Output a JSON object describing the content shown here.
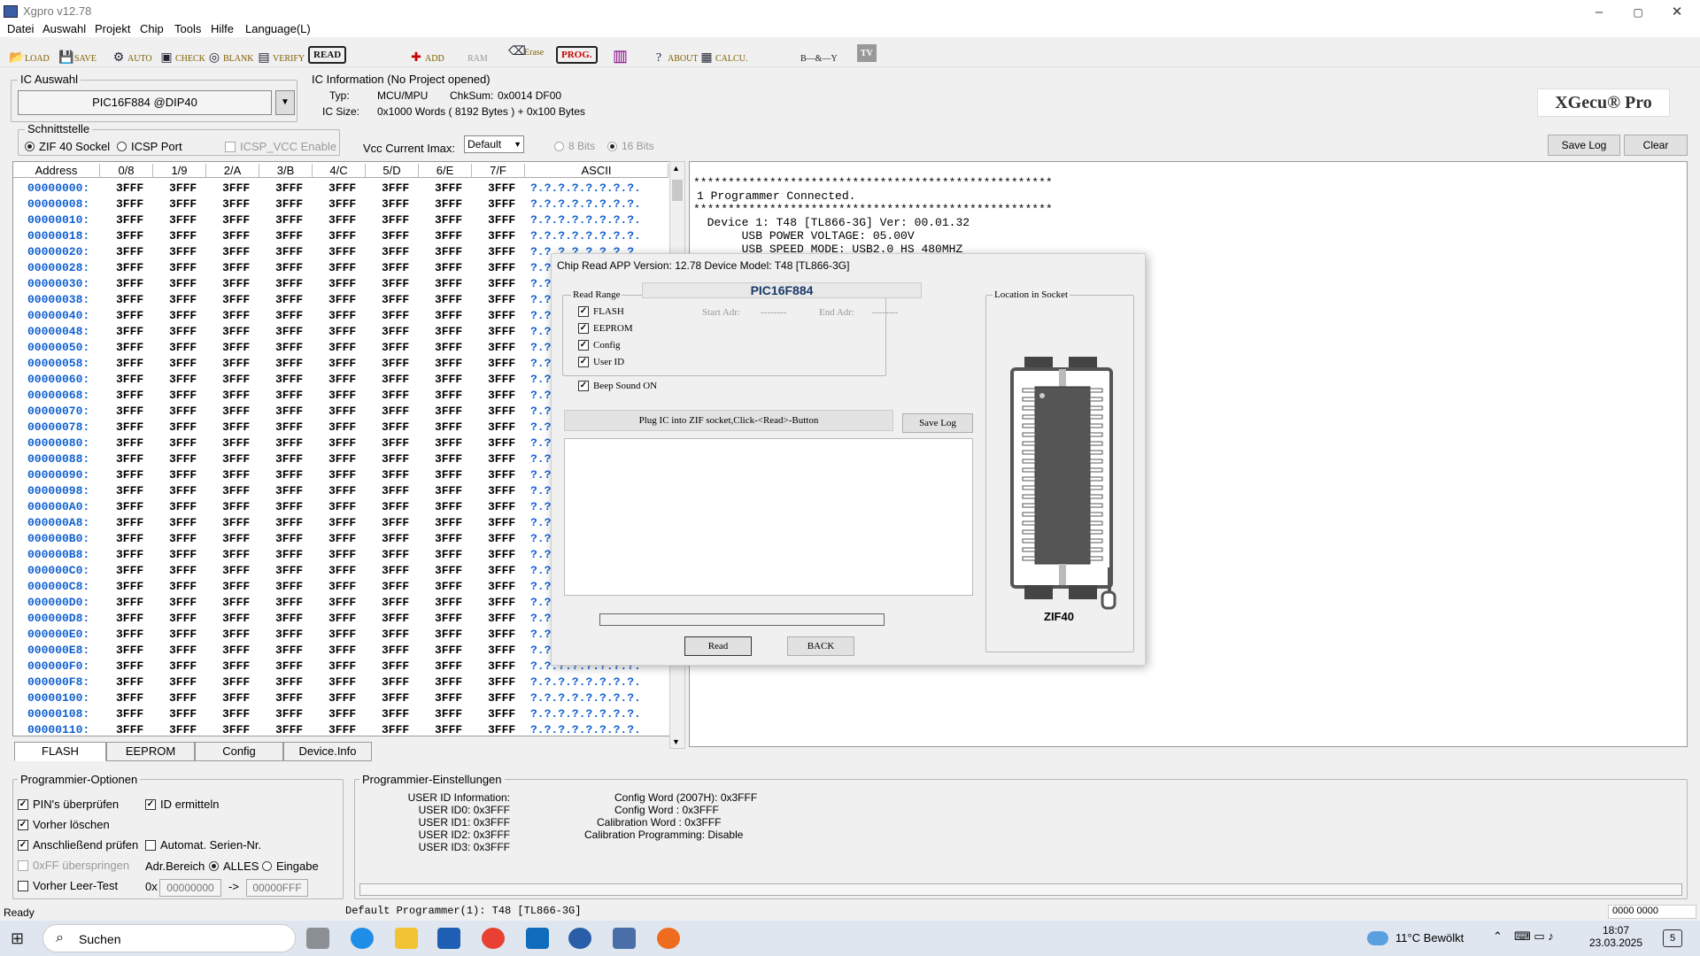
{
  "window": {
    "title": "Xgpro v12.78",
    "min": "–",
    "max": "▢",
    "close": "✕"
  },
  "menu": [
    "Datei",
    "Auswahl",
    "Projekt",
    "Chip",
    "Tools",
    "Hilfe",
    "Language(L)"
  ],
  "toolbar": {
    "load": "LOAD",
    "save": "SAVE",
    "auto": "AUTO",
    "check": "CHECK",
    "blank": "BLANK",
    "verify": "VERIFY",
    "read": "READ",
    "add": "ADD",
    "ram": "RAM",
    "erase": "Erase",
    "prog": "PROG.",
    "about": "ABOUT",
    "calcu": "CALCU.",
    "bey": "B—&—Y",
    "tv": "TV"
  },
  "ic_auswahl": {
    "label": "IC Auswahl",
    "value": "PIC16F884 @DIP40"
  },
  "ic_info": {
    "label": "IC Information (No Project opened)",
    "typ_label": "Typ:",
    "typ": "MCU/MPU",
    "chksum_label": "ChkSum:",
    "chksum": "0x0014 DF00",
    "size_label": "IC Size:",
    "size": "0x1000 Words ( 8192 Bytes ) + 0x100 Bytes"
  },
  "brand": "XGecu® Pro",
  "schnittstelle": {
    "label": "Schnittstelle",
    "zif": "ZIF 40 Sockel",
    "icsp": "ICSP Port",
    "icsp_vcc": "ICSP_VCC Enable"
  },
  "vcc": {
    "label": "Vcc Current Imax:",
    "value": "Default",
    "bits8": "8 Bits",
    "bits16": "16 Bits"
  },
  "log_buttons": {
    "save": "Save Log",
    "clear": "Clear"
  },
  "grid": {
    "headers": [
      "Address",
      "0/8",
      "1/9",
      "2/A",
      "3/B",
      "4/C",
      "5/D",
      "6/E",
      "7/F",
      "ASCII"
    ],
    "rows": [
      {
        "addr": "00000000:",
        "ascii": "?.?.?.?.?.?.?.?."
      },
      {
        "addr": "00000008:",
        "ascii": "?.?.?.?.?.?.?.?."
      },
      {
        "addr": "00000010:",
        "ascii": "?.?.?.?.?.?.?.?."
      },
      {
        "addr": "00000018:",
        "ascii": "?.?.?.?.?.?.?.?."
      },
      {
        "addr": "00000020:",
        "ascii": "?.?.?.?.?.?.?.?."
      },
      {
        "addr": "00000028:",
        "ascii": "?.?"
      },
      {
        "addr": "00000030:",
        "ascii": "?.?"
      },
      {
        "addr": "00000038:",
        "ascii": "?.?"
      },
      {
        "addr": "00000040:",
        "ascii": "?.?"
      },
      {
        "addr": "00000048:",
        "ascii": "?.?"
      },
      {
        "addr": "00000050:",
        "ascii": "?.?"
      },
      {
        "addr": "00000058:",
        "ascii": "?.?"
      },
      {
        "addr": "00000060:",
        "ascii": "?.?"
      },
      {
        "addr": "00000068:",
        "ascii": "?.?"
      },
      {
        "addr": "00000070:",
        "ascii": "?.?"
      },
      {
        "addr": "00000078:",
        "ascii": "?.?"
      },
      {
        "addr": "00000080:",
        "ascii": "?.?"
      },
      {
        "addr": "00000088:",
        "ascii": "?.?"
      },
      {
        "addr": "00000090:",
        "ascii": "?.?"
      },
      {
        "addr": "00000098:",
        "ascii": "?.?"
      },
      {
        "addr": "000000A0:",
        "ascii": "?.?"
      },
      {
        "addr": "000000A8:",
        "ascii": "?.?"
      },
      {
        "addr": "000000B0:",
        "ascii": "?.?"
      },
      {
        "addr": "000000B8:",
        "ascii": "?.?"
      },
      {
        "addr": "000000C0:",
        "ascii": "?.?"
      },
      {
        "addr": "000000C8:",
        "ascii": "?.?"
      },
      {
        "addr": "000000D0:",
        "ascii": "?.?"
      },
      {
        "addr": "000000D8:",
        "ascii": "?.?"
      },
      {
        "addr": "000000E0:",
        "ascii": "?.?"
      },
      {
        "addr": "000000E8:",
        "ascii": "?.?"
      },
      {
        "addr": "000000F0:",
        "ascii": "?.?.?.?.?.?.?.?."
      },
      {
        "addr": "000000F8:",
        "ascii": "?.?.?.?.?.?.?.?."
      },
      {
        "addr": "00000100:",
        "ascii": "?.?.?.?.?.?.?.?."
      },
      {
        "addr": "00000108:",
        "ascii": "?.?.?.?.?.?.?.?."
      },
      {
        "addr": "00000110:",
        "ascii": "?.?.?.?.?.?.?.?."
      }
    ],
    "cell": "3FFF"
  },
  "log_lines": [
    "****************************************************",
    "1 Programmer Connected.",
    "****************************************************",
    "  Device 1: T48 [TL866-3G] Ver: 00.01.32",
    "       USB POWER VOLTAGE: 05.00V",
    "       USB SPEED MODE: USB2.0 HS 480MHZ"
  ],
  "tabs": [
    "FLASH",
    "EEPROM",
    "Config",
    "Device.Info"
  ],
  "dialog": {
    "title": "Chip Read   APP Version: 12.78 Device Model: T48 [TL866-3G]",
    "chip": "PIC16F884",
    "read_range": "Read Range",
    "flash": "FLASH",
    "eeprom": "EEPROM",
    "config": "Config",
    "userid": "User ID",
    "start_label": "Start Adr:",
    "start_val": "--------",
    "end_label": "End Adr:",
    "end_val": "--------",
    "beep": "Beep Sound ON",
    "status": "Plug IC into ZIF socket,Click-<Read>-Button",
    "save_log": "Save Log",
    "read": "Read",
    "back": "BACK",
    "location": "Location in Socket",
    "zif": "ZIF40"
  },
  "options": {
    "label": "Programmier-Optionen",
    "pins": "PIN's überprüfen",
    "id": "ID ermitteln",
    "erase": "Vorher löschen",
    "verify": "Anschließend prüfen",
    "serial": "Automat. Serien-Nr.",
    "skipff": "0xFF überspringen",
    "adr": "Adr.Bereich",
    "alles": "ALLES",
    "eingabe": "Eingabe",
    "blank": "Vorher Leer-Test",
    "ox": "0x",
    "from": "00000000",
    "arrow": "->",
    "to": "00000FFF"
  },
  "settings": {
    "label": "Programmier-Einstellungen",
    "left": [
      "USER ID Information:",
      "USER ID0: 0x3FFF",
      "USER ID1: 0x3FFF",
      "USER ID2: 0x3FFF",
      "USER ID3: 0x3FFF"
    ],
    "right": [
      "Config Word (2007H): 0x3FFF",
      "Config Word : 0x3FFF",
      "Calibration Word : 0x3FFF",
      "Calibration Programming: Disable"
    ]
  },
  "statusbar": {
    "ready": "Ready",
    "programmer": "Default Programmer(1): T48 [TL866-3G]",
    "code": "0000 0000"
  },
  "taskbar": {
    "search": "Suchen",
    "weather": "11°C  Bewölkt",
    "time": "18:07",
    "date": "23.03.2025",
    "notif": "5"
  }
}
